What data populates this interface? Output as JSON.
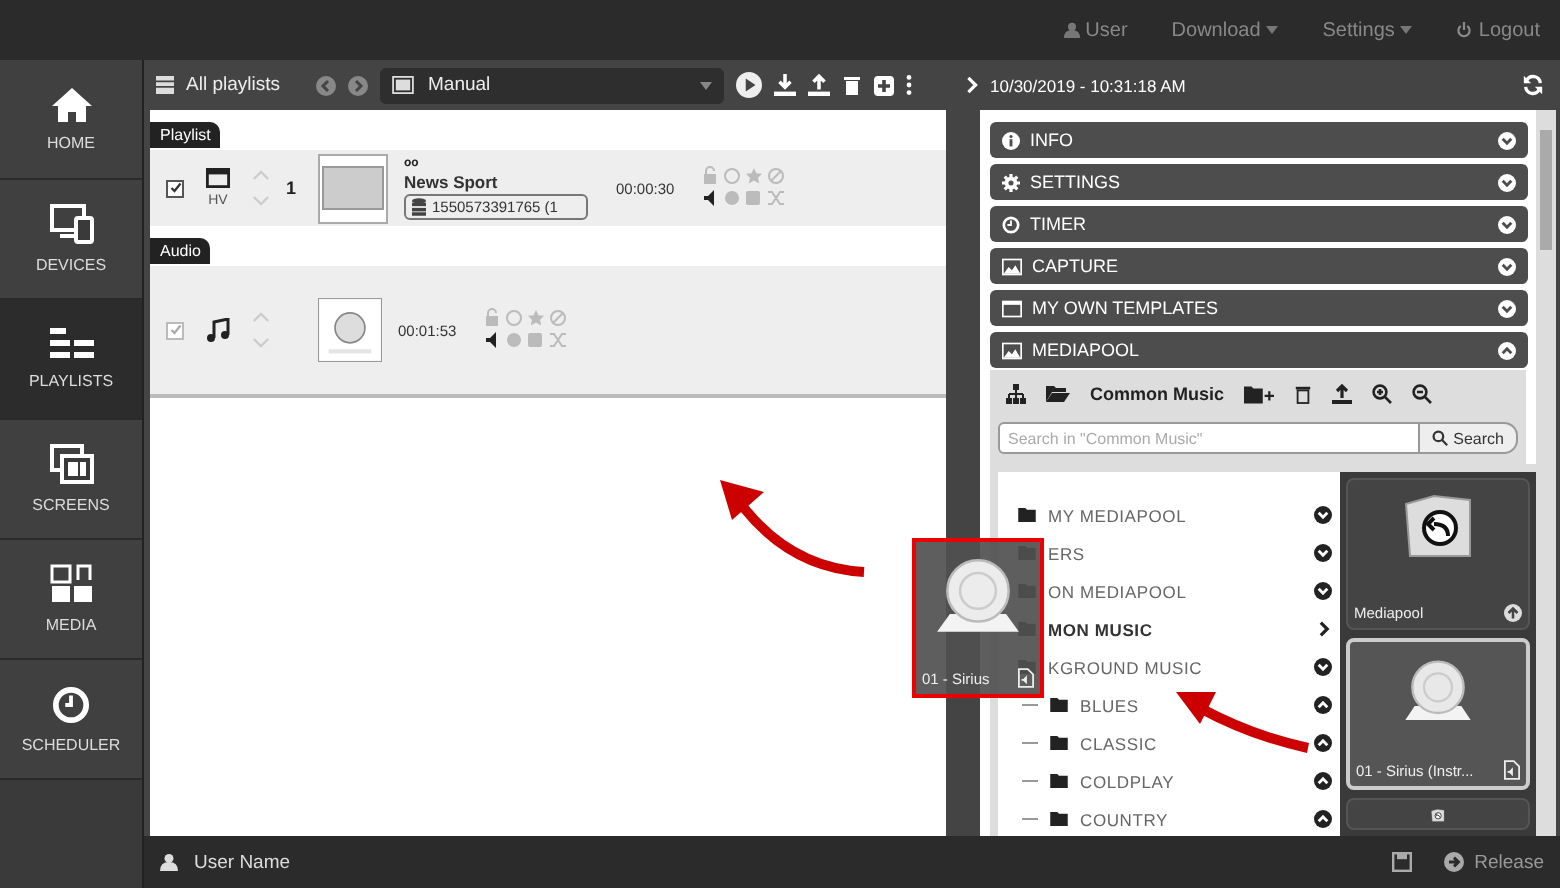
{
  "top_bar": {
    "links": [
      {
        "kind": "user",
        "label": "User"
      },
      {
        "kind": "dropdown",
        "label": "Download"
      },
      {
        "kind": "dropdown",
        "label": "Settings"
      },
      {
        "kind": "logout",
        "label": "Logout"
      }
    ]
  },
  "sidebar": {
    "items": [
      {
        "kind": "home",
        "label": "HOME",
        "selected": false
      },
      {
        "kind": "devices",
        "label": "DEVICES",
        "selected": false
      },
      {
        "kind": "playlists",
        "label": "PLAYLISTS",
        "selected": true
      },
      {
        "kind": "screens",
        "label": "SCREENS",
        "selected": false
      },
      {
        "kind": "media",
        "label": "MEDIA",
        "selected": false
      },
      {
        "kind": "scheduler",
        "label": "SCHEDULER",
        "selected": false
      }
    ]
  },
  "playlist_toolbar": {
    "title": "All playlists",
    "dropdown_value": "Manual"
  },
  "playlist": {
    "sections": [
      {
        "label": "Playlist",
        "rows": [
          {
            "kind": "screen",
            "checked": true,
            "disabled": false,
            "type_label": "HV",
            "number": "1",
            "badge": "oo",
            "title": "News Sport",
            "source": "1550573391765 (1",
            "duration": "00:00:30"
          }
        ]
      },
      {
        "label": "Audio",
        "rows": [
          {
            "kind": "audio",
            "checked": true,
            "disabled": true,
            "duration": "00:01:53"
          }
        ]
      }
    ]
  },
  "right_panel": {
    "timestamp": "10/30/2019 - 10:31:18 AM",
    "sections": [
      {
        "kind": "info",
        "label": "INFO",
        "expanded": false
      },
      {
        "kind": "settings",
        "label": "SETTINGS",
        "expanded": false
      },
      {
        "kind": "timer",
        "label": "TIMER",
        "expanded": false
      },
      {
        "kind": "capture",
        "label": "CAPTURE",
        "expanded": false
      },
      {
        "kind": "templates",
        "label": "MY OWN TEMPLATES",
        "expanded": false
      },
      {
        "kind": "mediapool",
        "label": "MEDIAPOOL",
        "expanded": true
      }
    ]
  },
  "mediapool": {
    "folder": "Common Music",
    "search": {
      "placeholder": "Search in \"Common Music\"",
      "button": "Search"
    },
    "tree": [
      {
        "label": "MY MEDIAPOOL",
        "selected": false,
        "expanded": false
      },
      {
        "label": "ERS",
        "selected": false,
        "expanded": false
      },
      {
        "label": "ON MEDIAPOOL",
        "selected": false,
        "expanded": false
      },
      {
        "label": "MON MUSIC",
        "selected": true
      },
      {
        "label": "KGROUND MUSIC",
        "selected": false,
        "expanded": false,
        "children": [
          {
            "label": "BLUES",
            "selected": false,
            "expanded": true
          },
          {
            "label": "CLASSIC",
            "selected": false,
            "expanded": true
          },
          {
            "label": "COLDPLAY",
            "selected": false,
            "expanded": true
          },
          {
            "label": "COUNTRY",
            "selected": false,
            "expanded": true
          }
        ]
      }
    ],
    "tiles": [
      {
        "kind": "folder",
        "label": "Mediapool",
        "selected": false
      },
      {
        "kind": "audio",
        "label": "01 - Sirius (Instr...",
        "selected": true
      },
      {
        "kind": "folder",
        "selected": false
      }
    ]
  },
  "drag_preview": {
    "label": "01 - Sirius"
  },
  "bottom_bar": {
    "user": "User Name",
    "release": "Release"
  }
}
